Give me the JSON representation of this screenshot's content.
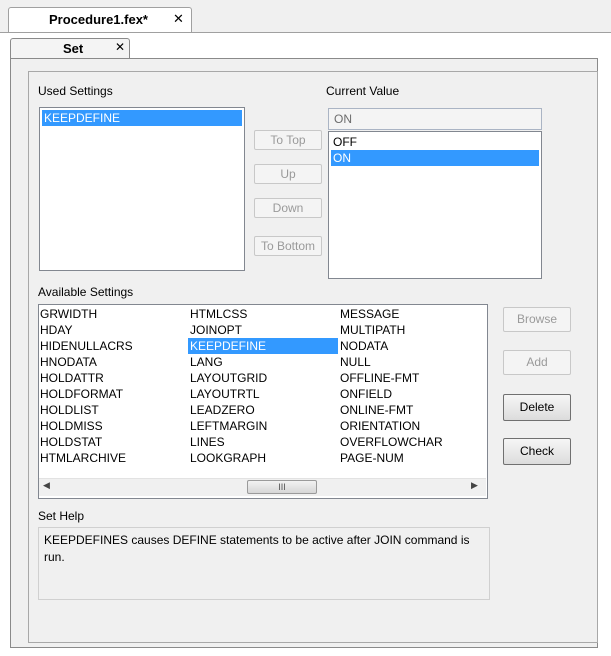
{
  "document_tab": {
    "title": "Procedure1.fex*",
    "close": "✕"
  },
  "panel_tab": {
    "title": "Set",
    "close": "✕"
  },
  "used_settings": {
    "label": "Used Settings",
    "items": [
      "KEEPDEFINE"
    ],
    "selected": "KEEPDEFINE"
  },
  "current_value": {
    "label": "Current Value",
    "field_value": "ON",
    "options": [
      "OFF",
      "ON"
    ],
    "selected": "ON"
  },
  "order_buttons": {
    "to_top": "To Top",
    "up": "Up",
    "down": "Down",
    "to_bottom": "To Bottom"
  },
  "available_settings": {
    "label": "Available Settings",
    "columns": [
      [
        "GRWIDTH",
        "HDAY",
        "HIDENULLACRS",
        "HNODATA",
        "HOLDATTR",
        "HOLDFORMAT",
        "HOLDLIST",
        "HOLDMISS",
        "HOLDSTAT",
        "HTMLARCHIVE"
      ],
      [
        "HTMLCSS",
        "JOINOPT",
        "KEEPDEFINE",
        "LANG",
        "LAYOUTGRID",
        "LAYOUTRTL",
        "LEADZERO",
        "LEFTMARGIN",
        "LINES",
        "LOOKGRAPH"
      ],
      [
        "MESSAGE",
        "MULTIPATH",
        "NODATA",
        "NULL",
        "OFFLINE-FMT",
        "ONFIELD",
        "ONLINE-FMT",
        "ORIENTATION",
        "OVERFLOWCHAR",
        "PAGE-NUM"
      ]
    ],
    "selected": "KEEPDEFINE",
    "scroll_thumb_glyph": "III",
    "scroll_left": "◀",
    "scroll_right": "▶"
  },
  "side_buttons": {
    "browse": "Browse",
    "add": "Add",
    "delete": "Delete",
    "check": "Check"
  },
  "set_help": {
    "label": "Set Help",
    "text": "KEEPDEFINES causes DEFINE statements to be active after JOIN command is run."
  }
}
